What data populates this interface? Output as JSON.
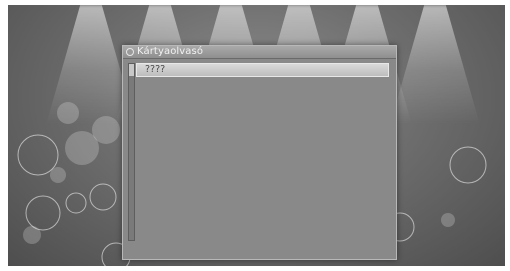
{
  "dialog": {
    "title": "Kártyaolvasó",
    "items": [
      {
        "label": "????"
      }
    ]
  },
  "icons": {
    "title": "title-bullet-icon",
    "scroll": "scrollbar-thumb"
  },
  "colors": {
    "background": "#6e6e6e",
    "dialog": "#898989",
    "selected_item": "#cfcfcf",
    "title_text": "#f2f2f2"
  }
}
